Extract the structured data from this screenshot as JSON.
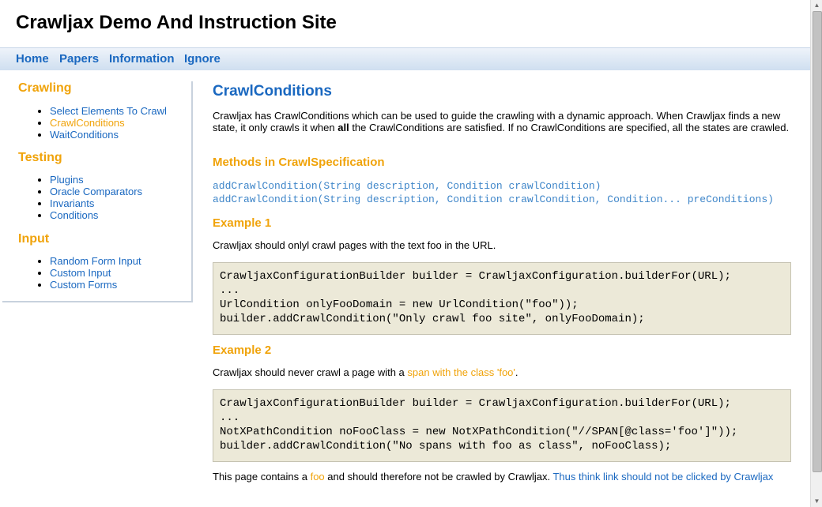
{
  "site": {
    "title": "Crawljax Demo And Instruction Site"
  },
  "topnav": [
    "Home",
    "Papers",
    "Information",
    "Ignore"
  ],
  "sidebar": {
    "sections": [
      {
        "heading": "Crawling",
        "items": [
          "Select Elements To Crawl",
          "CrawlConditions",
          "WaitConditions"
        ]
      },
      {
        "heading": "Testing",
        "items": [
          "Plugins",
          "Oracle Comparators",
          "Invariants",
          "Conditions"
        ]
      },
      {
        "heading": "Input",
        "items": [
          "Random Form Input",
          "Custom Input",
          "Custom Forms"
        ]
      }
    ]
  },
  "main": {
    "title": "CrawlConditions",
    "intro_pre": "Crawljax has CrawlConditions which can be used to guide the crawling with a dynamic approach. When Crawljax finds a new state, it only crawls it when ",
    "intro_bold": "all",
    "intro_post": " the CrawlConditions are satisfied. If no CrawlConditions are specified, all the states are crawled.",
    "methods_heading": "Methods in CrawlSpecification",
    "methods": [
      "addCrawlCondition(String description, Condition crawlCondition)",
      "addCrawlCondition(String description, Condition crawlCondition, Condition... preConditions)"
    ],
    "example1": {
      "heading": "Example 1",
      "text": "Crawljax should onlyl crawl pages with the text foo in the URL.",
      "code": [
        "CrawljaxConfigurationBuilder builder = CrawljaxConfiguration.builderFor(URL);",
        "...",
        "UrlCondition onlyFooDomain = new UrlCondition(\"foo\"));",
        "builder.addCrawlCondition(\"Only crawl foo site\", onlyFooDomain);"
      ]
    },
    "example2": {
      "heading": "Example 2",
      "text_pre": "Crawljax should never crawl a page with a ",
      "text_link": "span with the class 'foo'",
      "text_post": ".",
      "code": [
        "CrawljaxConfigurationBuilder builder = CrawljaxConfiguration.builderFor(URL);",
        "...",
        "NotXPathCondition noFooClass = new NotXPathCondition(\"//SPAN[@class='foo']\"));",
        "builder.addCrawlCondition(\"No spans with foo as class\", noFooClass);"
      ]
    },
    "footer": {
      "pre": "This page contains a ",
      "foo": "foo",
      "mid": " and should therefore not be crawled by Crawljax. ",
      "link": "Thus think link should not be clicked by Crawljax"
    }
  },
  "colors": {
    "link_blue": "#1a68c0",
    "accent_orange": "#f0a30a",
    "code_bg": "#ece9d8",
    "method_blue": "#3f86c9"
  },
  "scrollbar": {
    "up_icon": "arrow-up-icon",
    "down_icon": "arrow-down-icon"
  }
}
